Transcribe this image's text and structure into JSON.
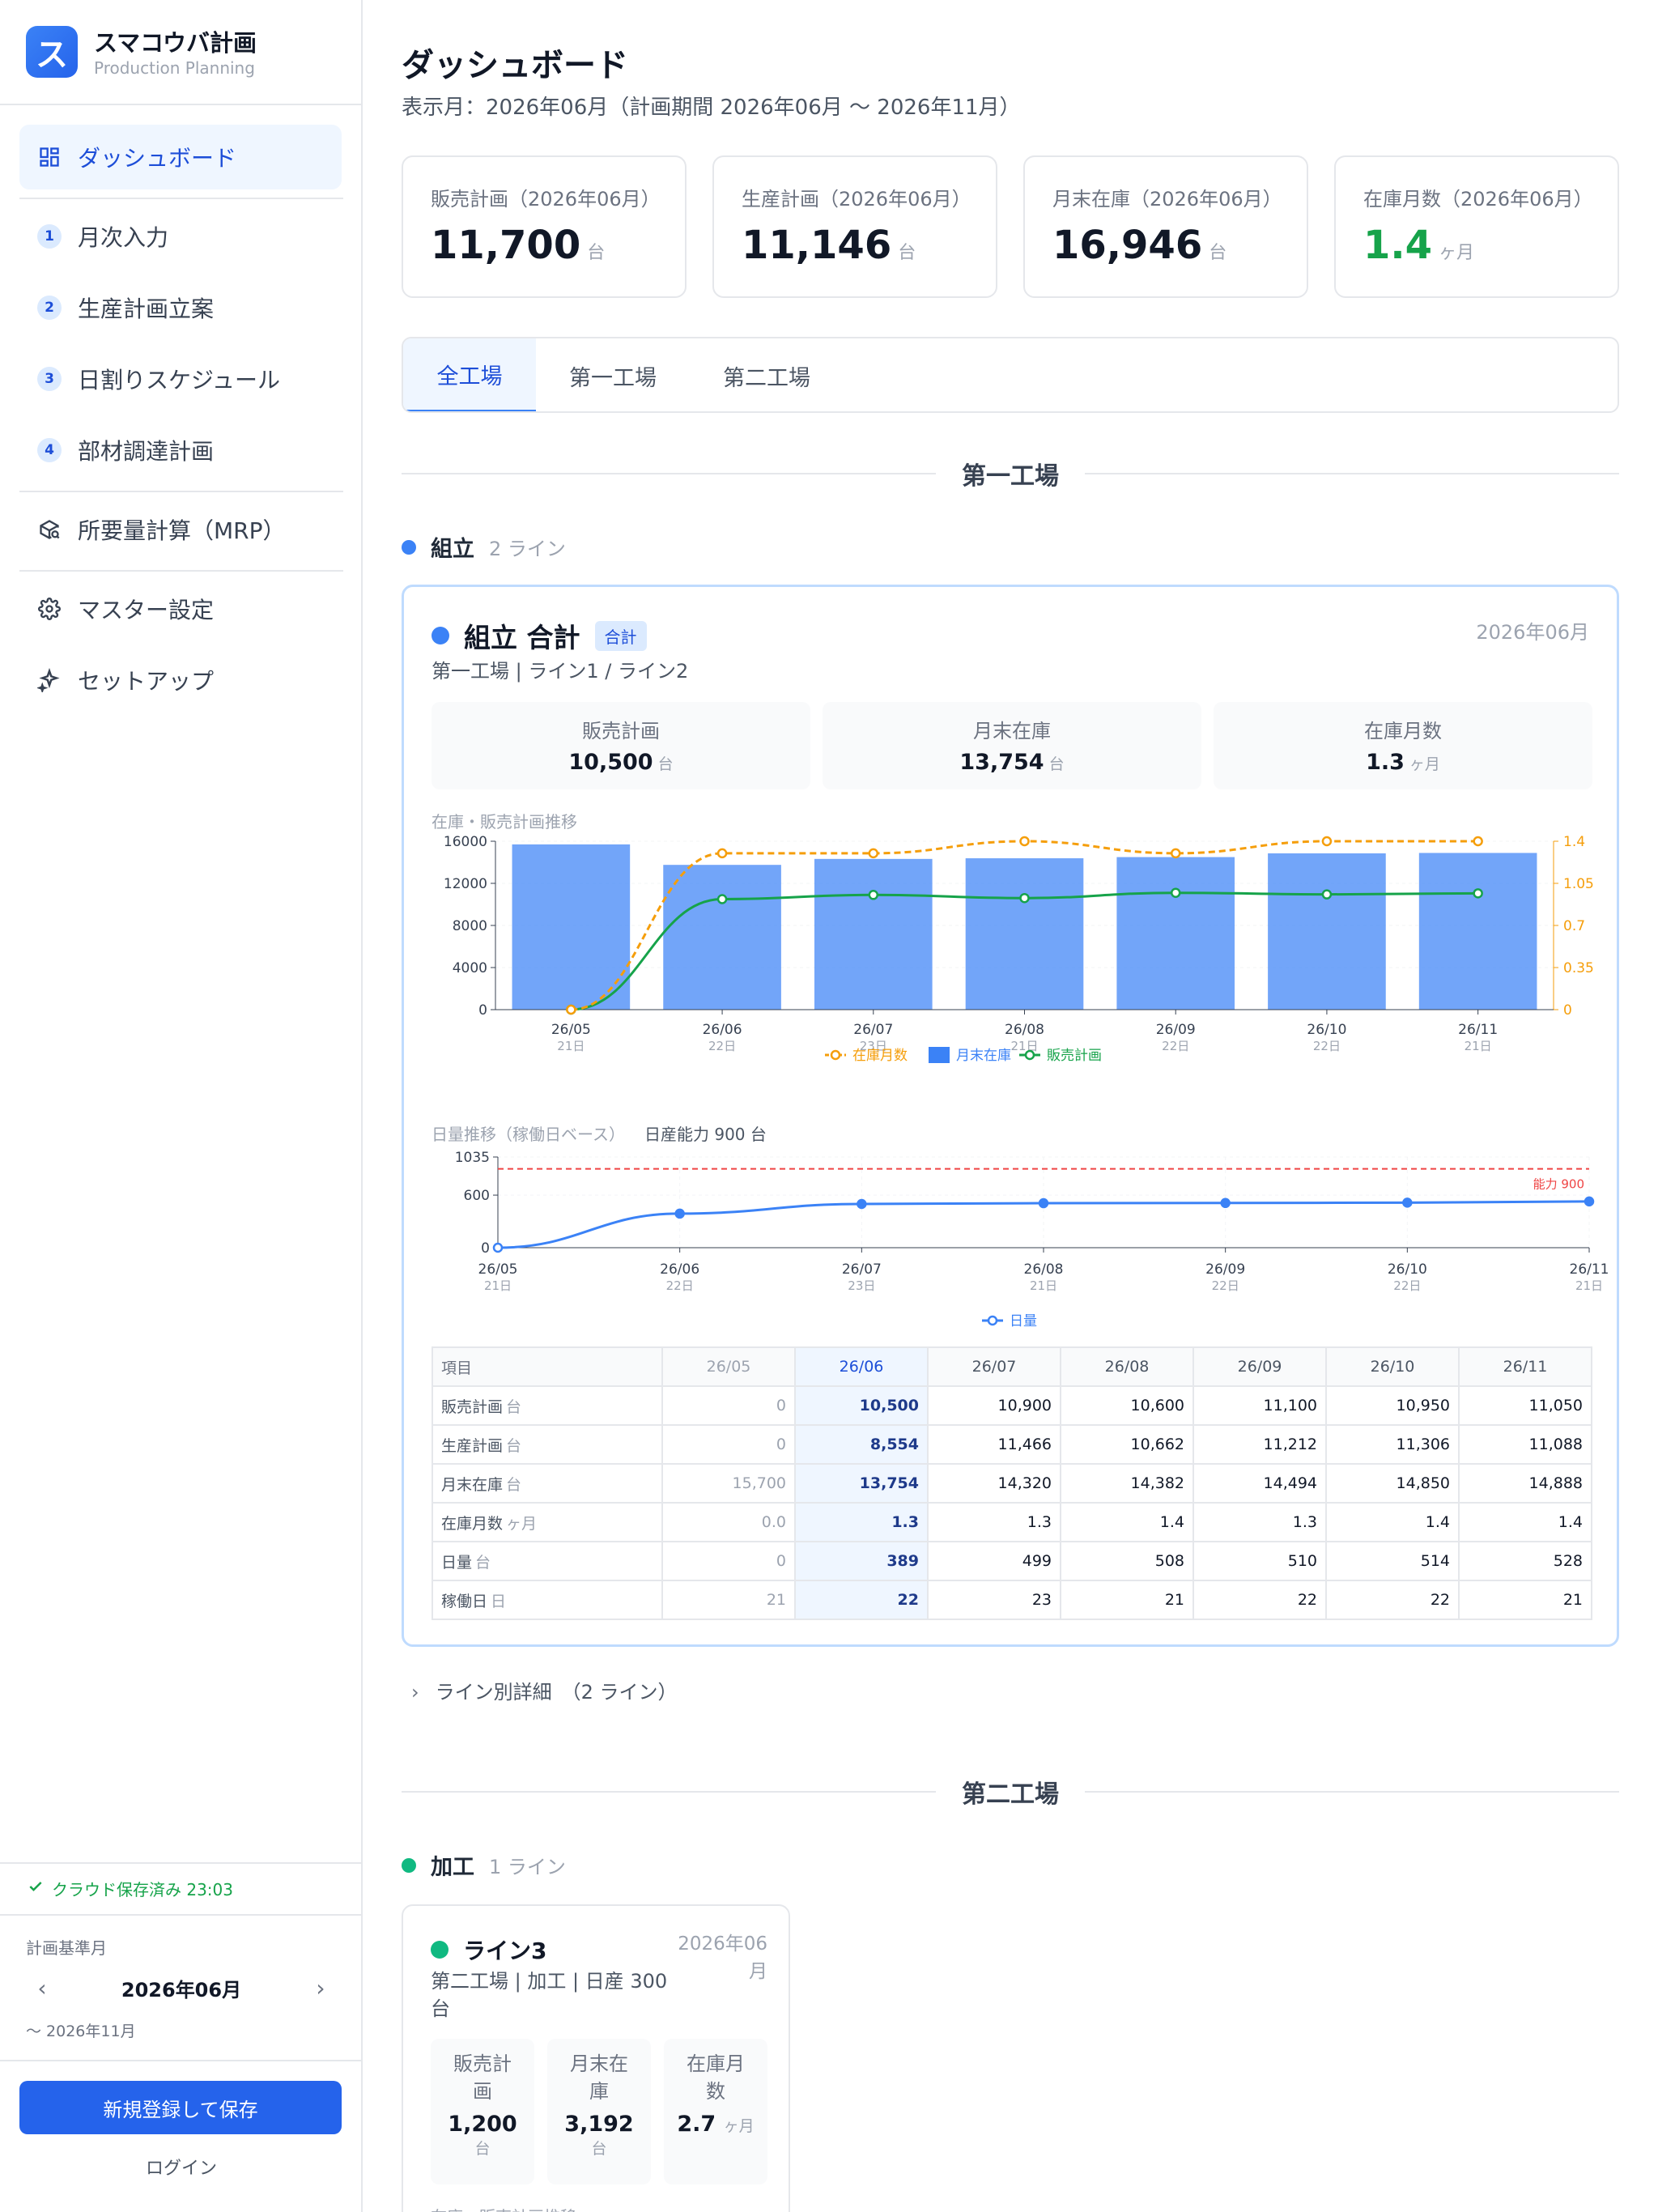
{
  "app": {
    "title": "スマコウバ計画",
    "subtitle": "Production Planning",
    "logo_letter": "ス"
  },
  "nav": {
    "dashboard": "ダッシュボード",
    "monthly_input": "月次入力",
    "production_plan": "生産計画立案",
    "daily_schedule": "日割りスケジュール",
    "procurement": "部材調達計画",
    "mrp": "所要量計算（MRP）",
    "master": "マスター設定",
    "setup": "セットアップ",
    "step_numbers": [
      "1",
      "2",
      "3",
      "4"
    ]
  },
  "sidebar_footer": {
    "saved_status": "クラウド保存済み 23:03",
    "plan_base_label": "計画基準月",
    "base_month": "2026年06月",
    "until": "〜 2026年11月",
    "save_button": "新規登録して保存",
    "login": "ログイン"
  },
  "page": {
    "title": "ダッシュボード",
    "subtitle": "表示月：2026年06月（計画期間 2026年06月 〜 2026年11月）"
  },
  "kpis": [
    {
      "label": "販売計画（2026年06月）",
      "value": "11,700",
      "unit": "台"
    },
    {
      "label": "生産計画（2026年06月）",
      "value": "11,146",
      "unit": "台"
    },
    {
      "label": "月末在庫（2026年06月）",
      "value": "16,946",
      "unit": "台"
    },
    {
      "label": "在庫月数（2026年06月）",
      "value": "1.4",
      "unit": "ヶ月"
    }
  ],
  "tabs": [
    "全工場",
    "第一工場",
    "第二工場"
  ],
  "factory1": {
    "title": "第一工場",
    "group": "組立",
    "group_count": "2 ライン"
  },
  "card1": {
    "title": "組立 合計",
    "badge": "合計",
    "month": "2026年06月",
    "sub": "第一工場 | ライン1 / ライン2",
    "stats": [
      {
        "label": "販売計画",
        "value": "10,500",
        "unit": "台"
      },
      {
        "label": "月末在庫",
        "value": "13,754",
        "unit": "台"
      },
      {
        "label": "在庫月数",
        "value": "1.3",
        "unit": "ヶ月"
      }
    ],
    "chart1_label": "在庫・販売計画推移",
    "chart2_label": "日量推移（稼働日ベース）",
    "chart2_capacity": "日産能力 900 台"
  },
  "chart_data": [
    {
      "type": "bar",
      "title": "在庫・販売計画推移",
      "categories": [
        "26/05",
        "26/06",
        "26/07",
        "26/08",
        "26/09",
        "26/10",
        "26/11"
      ],
      "sublabels": [
        "21日",
        "22日",
        "23日",
        "21日",
        "22日",
        "22日",
        "21日"
      ],
      "series": [
        {
          "name": "月末在庫",
          "type": "bar",
          "axis": "left",
          "color": "#3b82f6",
          "values": [
            15700,
            13754,
            14320,
            14382,
            14494,
            14850,
            14888
          ]
        },
        {
          "name": "販売計画",
          "type": "line",
          "axis": "left",
          "color": "#16a34a",
          "values": [
            0,
            10500,
            10900,
            10600,
            11100,
            10950,
            11050
          ]
        },
        {
          "name": "在庫月数",
          "type": "line",
          "axis": "right",
          "color": "#f59e0b",
          "dashed": true,
          "values": [
            0.0,
            1.3,
            1.3,
            1.4,
            1.3,
            1.4,
            1.4
          ]
        }
      ],
      "legend": [
        "在庫月数",
        "月末在庫",
        "販売計画"
      ],
      "y_left": {
        "min": 0,
        "max": 16000,
        "ticks": [
          "0",
          "4000",
          "8000",
          "12000",
          "16000"
        ]
      },
      "y_right": {
        "min": 0,
        "max": 1.4,
        "ticks": [
          "0",
          "0.35",
          "0.7",
          "1.05",
          "1.4"
        ]
      },
      "legend_position": "bottom"
    },
    {
      "type": "line",
      "title": "日量推移（稼働日ベース）",
      "categories": [
        "26/05",
        "26/06",
        "26/07",
        "26/08",
        "26/09",
        "26/10",
        "26/11"
      ],
      "sublabels": [
        "21日",
        "22日",
        "23日",
        "21日",
        "22日",
        "22日",
        "21日"
      ],
      "series": [
        {
          "name": "日量",
          "color": "#3b82f6",
          "values": [
            0,
            389,
            499,
            508,
            510,
            514,
            528
          ]
        }
      ],
      "reference_line": {
        "label": "能力 900",
        "value": 900,
        "color": "#ef4444"
      },
      "y": {
        "min": 0,
        "max": 1035,
        "ticks": [
          "0",
          "600",
          "1035"
        ]
      },
      "legend": [
        "日量"
      ],
      "legend_position": "bottom"
    }
  ],
  "table": {
    "headers": [
      "項目",
      "26/05",
      "26/06",
      "26/07",
      "26/08",
      "26/09",
      "26/10",
      "26/11"
    ],
    "rows": [
      {
        "label": "販売計画",
        "unit": "台",
        "values": [
          "0",
          "10,500",
          "10,900",
          "10,600",
          "11,100",
          "10,950",
          "11,050"
        ]
      },
      {
        "label": "生産計画",
        "unit": "台",
        "values": [
          "0",
          "8,554",
          "11,466",
          "10,662",
          "11,212",
          "11,306",
          "11,088"
        ]
      },
      {
        "label": "月末在庫",
        "unit": "台",
        "values": [
          "15,700",
          "13,754",
          "14,320",
          "14,382",
          "14,494",
          "14,850",
          "14,888"
        ]
      },
      {
        "label": "在庫月数",
        "unit": "ヶ月",
        "values": [
          "0.0",
          "1.3",
          "1.3",
          "1.4",
          "1.3",
          "1.4",
          "1.4"
        ]
      },
      {
        "label": "日量",
        "unit": "台",
        "values": [
          "0",
          "389",
          "499",
          "508",
          "510",
          "514",
          "528"
        ]
      },
      {
        "label": "稼働日",
        "unit": "日",
        "values": [
          "21",
          "22",
          "23",
          "21",
          "22",
          "22",
          "21"
        ]
      }
    ]
  },
  "line_detail": "ライン別詳細　（2 ライン）",
  "factory2": {
    "title": "第二工場",
    "group": "加工",
    "group_count": "1 ライン"
  },
  "card2": {
    "title": "ライン3",
    "month_line1": "2026年06",
    "month_line2": "月",
    "sub": "第二工場 | 加工 | 日産 300 台",
    "stats": [
      {
        "label_line1": "販売計",
        "label_line2": "画",
        "value": "1,200",
        "unit": "台"
      },
      {
        "label_line1": "月末在",
        "label_line2": "庫",
        "value": "3,192",
        "unit": "台"
      },
      {
        "label_line1": "在庫月",
        "label_line2": "数",
        "value": "2.7",
        "unit": "ヶ月"
      }
    ],
    "bottom_label": "在庫・販売計画推移"
  }
}
